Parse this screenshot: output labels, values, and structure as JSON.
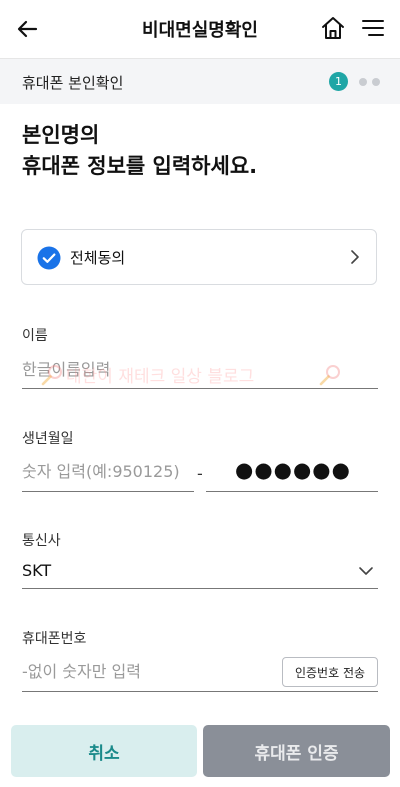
{
  "header": {
    "title": "비대면실명확인",
    "back_icon": "arrow-left-icon",
    "home_icon": "home-icon",
    "menu_icon": "menu-icon"
  },
  "step": {
    "label": "휴대폰 본인확인",
    "current": "1",
    "total": 3,
    "accent": "#1fa6a6"
  },
  "heading": {
    "line1": "본인명의",
    "line2": "휴대폰 정보를 입력하세요."
  },
  "agreement": {
    "label": "전체동의",
    "checked": true,
    "check_color": "#1a73e8"
  },
  "name_field": {
    "label": "이름",
    "placeholder": "한글이름입력"
  },
  "watermark": {
    "text": "대한이 재테크 일상 블로그"
  },
  "birth_field": {
    "label": "생년월일",
    "placeholder": "숫자 입력(예:950125)",
    "separator": "-",
    "masked": "●●●●●●"
  },
  "carrier_field": {
    "label": "통신사",
    "value": "SKT"
  },
  "phone_field": {
    "label": "휴대폰번호",
    "placeholder": "-없이 숫자만 입력",
    "send_button": "인증번호 전송"
  },
  "footer": {
    "cancel": "취소",
    "verify": "휴대폰 인증"
  }
}
